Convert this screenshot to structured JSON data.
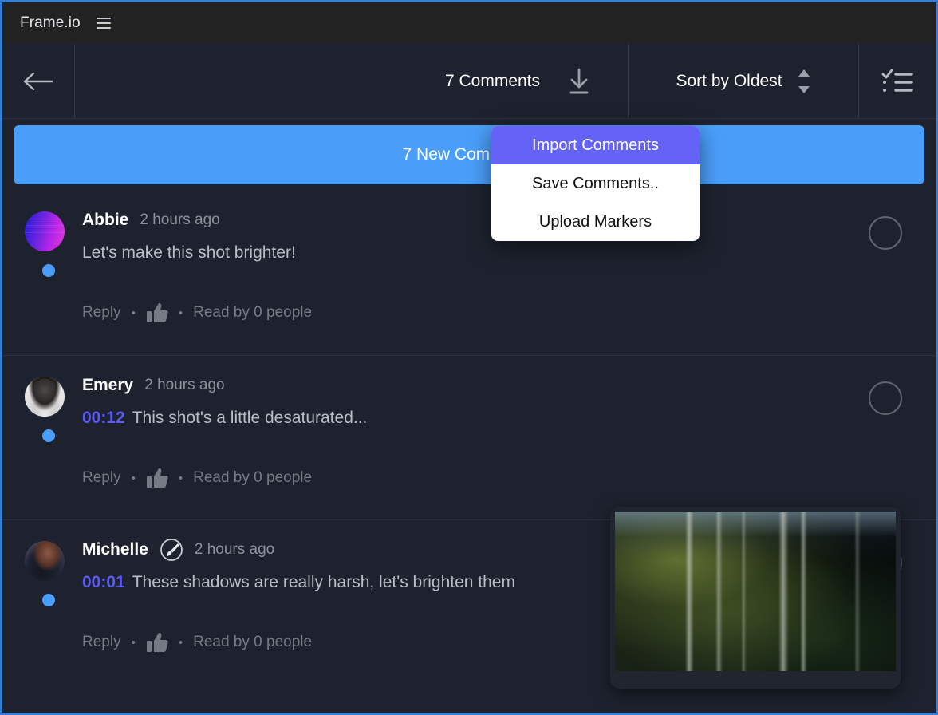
{
  "window": {
    "accent_blue": "#4a9efa",
    "accent_purple": "#6563f5",
    "timestamp_color": "#5b5bf0",
    "titlebar_bg": "#222222",
    "content_bg": "#1d222e"
  },
  "titlebar": {
    "brand": "Frame.io",
    "menu_icon": "hamburger-icon"
  },
  "toolbar": {
    "back_icon": "back-arrow-icon",
    "comments_count_label": "7 Comments",
    "download_icon": "download-icon",
    "sort_label": "Sort by Oldest",
    "sort_chevrons_icon": "chevron-up-down-icon",
    "checklist_icon": "checklist-icon"
  },
  "banner": {
    "label": "7 New Comments"
  },
  "dropdown": {
    "items": [
      {
        "label": "Import Comments",
        "active": true
      },
      {
        "label": "Save Comments..",
        "active": false
      },
      {
        "label": "Upload Markers",
        "active": false
      }
    ]
  },
  "comments": [
    {
      "author": "Abbie",
      "time": "2 hours ago",
      "timestamp": "",
      "text": "Let's make this shot brighter!",
      "has_annotation_badge": false,
      "reply_label": "Reply",
      "like_icon": "thumbs-up-icon",
      "read_label": "Read by 0 people",
      "unread": true,
      "avatar": "avatar-abbie"
    },
    {
      "author": "Emery",
      "time": "2 hours ago",
      "timestamp": "00:12",
      "text": "This shot's a little desaturated...",
      "has_annotation_badge": false,
      "reply_label": "Reply",
      "like_icon": "thumbs-up-icon",
      "read_label": "Read by 0 people",
      "unread": true,
      "avatar": "avatar-emery"
    },
    {
      "author": "Michelle",
      "time": "2 hours ago",
      "timestamp": "00:01",
      "text": "These shadows are really harsh, let's brighten them",
      "has_annotation_badge": true,
      "badge_icon": "paintbrush-icon",
      "reply_label": "Reply",
      "like_icon": "thumbs-up-icon",
      "read_label": "Read by 0 people",
      "unread": true,
      "avatar": "avatar-michelle"
    }
  ],
  "video_thumbnail": {
    "name": "forest-frame-thumbnail"
  },
  "separators": {
    "dot": "•"
  }
}
